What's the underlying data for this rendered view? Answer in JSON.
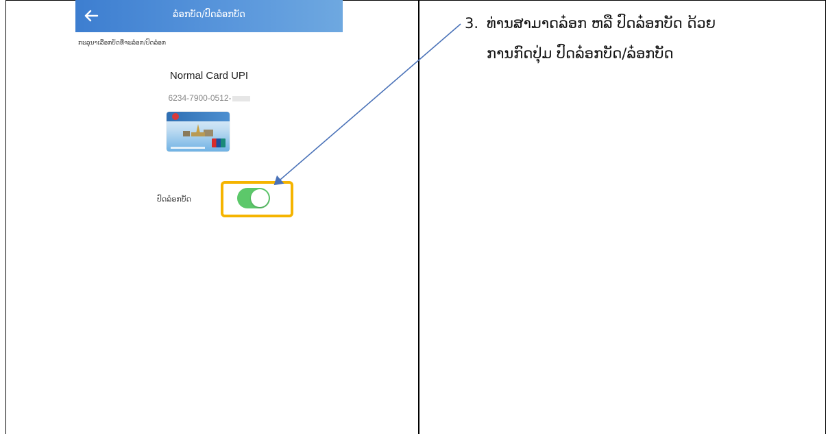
{
  "phone": {
    "header": {
      "title": "ລ໋ອກບັດ/ປົດລ໋ອກບັດ",
      "back_icon": "arrow-left-icon"
    },
    "instruction": "ກະລຸນາເລືອກບັດທີ່ຈະລ໋ອກ/ປົດລ໋ອກ",
    "card": {
      "name": "Normal Card UPI",
      "number_visible": "6234-7900-0512-"
    },
    "toggle": {
      "label": "ປົດລ໋ອກບັດ",
      "state": "on",
      "on_color": "#5cc86a"
    },
    "header_color": "#3d7ed0",
    "highlight_color": "#f5b400"
  },
  "instruction_panel": {
    "step_number": "3.",
    "line1": "ທ່ານສາມາດລ໋ອກ ຫລື ປົດລ໋ອກບັດ ດ້ວຍ",
    "line2": "ການກົດປຸ່ມ ປົດລ໋ອກບັດ/ລ໋ອກບັດ"
  },
  "arrow_color": "#4a72b8"
}
